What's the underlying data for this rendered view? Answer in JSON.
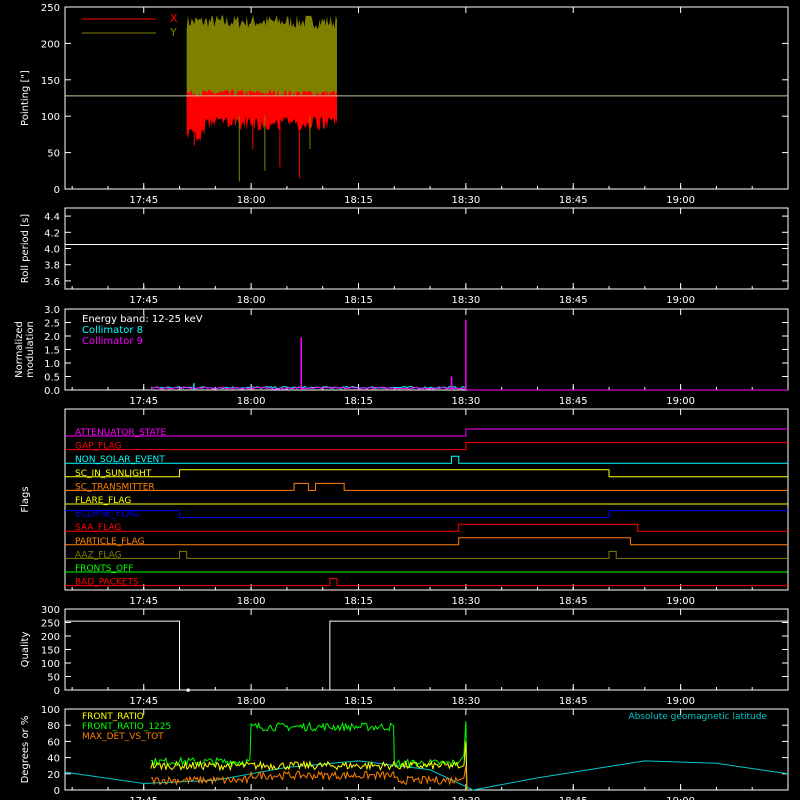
{
  "time_ticks": [
    "17:45",
    "18:00",
    "18:15",
    "18:30",
    "18:45",
    "19:00"
  ],
  "colors": {
    "background": "#000000",
    "axes": "#ffffff",
    "x_series": "#ff0000",
    "y_series": "#808000",
    "collimator_8": "#00ffff",
    "collimator_9": "#ff00ff",
    "front_ratio": "#ffff00",
    "front_ratio_1225": "#00ff00",
    "max_det_vs_tot": "#ff8000",
    "geomag": "#00c8c8"
  },
  "chart_data": [
    {
      "type": "area",
      "ylabel": "Pointing [\"]",
      "ylim": [
        0,
        250
      ],
      "yticks": [
        0,
        50,
        100,
        150,
        200,
        250
      ],
      "xlim": [
        "17:34",
        "19:15"
      ],
      "series": [
        {
          "name": "X",
          "color": "#ff0000",
          "x_range": [
            "17:51",
            "18:12"
          ],
          "band": [
            90,
            135
          ]
        },
        {
          "name": "Y",
          "color": "#808000",
          "x_range": [
            "17:51",
            "18:12"
          ],
          "band": [
            115,
            230
          ]
        }
      ],
      "reference_line": 128
    },
    {
      "type": "line",
      "ylabel": "Roll period [s]",
      "ylim": [
        3.5,
        4.5
      ],
      "yticks": [
        "3.6",
        "3.8",
        "4.0",
        "4.2",
        "4.4"
      ],
      "xlim": [
        "17:34",
        "19:15"
      ],
      "series": [
        {
          "name": "",
          "color": "#ffffff",
          "x": [
            "17:34",
            "19:15"
          ],
          "y": [
            4.05,
            4.05
          ]
        }
      ]
    },
    {
      "type": "line",
      "ylabel": "Normalized modulation",
      "ylim": [
        0,
        3
      ],
      "yticks": [
        "0.0",
        "0.5",
        "1.0",
        "1.5",
        "2.0",
        "2.5",
        "3.0"
      ],
      "xlim": [
        "17:34",
        "19:15"
      ],
      "legend": [
        "Energy band: 12-25 keV",
        "Collimator 8",
        "Collimator 9"
      ],
      "series": [
        {
          "name": "Collimator 8",
          "color": "#00ffff",
          "x_range": [
            "17:46",
            "18:30"
          ],
          "baseline": 0.05,
          "spikes": [
            [
              "17:52",
              0.25
            ],
            [
              "18:28",
              0.2
            ]
          ]
        },
        {
          "name": "Collimator 9",
          "color": "#ff00ff",
          "x_range": [
            "17:46",
            "18:30"
          ],
          "baseline": 0.03,
          "spikes": [
            [
              "18:07",
              1.95
            ],
            [
              "18:30",
              2.6
            ],
            [
              "18:28",
              0.5
            ]
          ]
        }
      ]
    },
    {
      "type": "line",
      "ylabel": "Flags",
      "xlim": [
        "17:34",
        "19:15"
      ],
      "flags": [
        {
          "name": "ATTENUATOR_STATE",
          "color": "#ff00ff",
          "steps": [
            [
              "17:34",
              0
            ],
            [
              "18:30",
              1
            ]
          ]
        },
        {
          "name": "GAP_FLAG",
          "color": "#ff0000",
          "steps": [
            [
              "17:34",
              0
            ],
            [
              "18:30",
              1
            ]
          ]
        },
        {
          "name": "NON_SOLAR_EVENT",
          "color": "#00ffff",
          "steps": [
            [
              "17:34",
              0
            ],
            [
              "18:28",
              1
            ],
            [
              "18:29",
              0
            ]
          ]
        },
        {
          "name": "SC_IN_SUNLIGHT",
          "color": "#ffff00",
          "steps": [
            [
              "17:34",
              0
            ],
            [
              "17:50",
              1
            ],
            [
              "18:50",
              0
            ]
          ]
        },
        {
          "name": "SC_TRANSMITTER",
          "color": "#ff8000",
          "steps": [
            [
              "17:34",
              0
            ],
            [
              "18:06",
              1
            ],
            [
              "18:08",
              0
            ],
            [
              "18:09",
              1
            ],
            [
              "18:13",
              0
            ]
          ]
        },
        {
          "name": "FLARE_FLAG",
          "color": "#ffff00",
          "steps": [
            [
              "17:34",
              0
            ]
          ]
        },
        {
          "name": "ECLIPSE_FLAG",
          "color": "#0000ff",
          "steps": [
            [
              "17:34",
              1
            ],
            [
              "17:50",
              0
            ],
            [
              "18:50",
              1
            ]
          ]
        },
        {
          "name": "SAA_FLAG",
          "color": "#ff0000",
          "steps": [
            [
              "17:34",
              0
            ],
            [
              "18:29",
              1
            ],
            [
              "18:54",
              0
            ]
          ]
        },
        {
          "name": "PARTICLE_FLAG",
          "color": "#ff8000",
          "steps": [
            [
              "17:34",
              0
            ],
            [
              "18:29",
              1
            ],
            [
              "18:53",
              0
            ]
          ]
        },
        {
          "name": "AAZ_FLAG",
          "color": "#808000",
          "steps": [
            [
              "17:34",
              0
            ],
            [
              "17:50",
              1
            ],
            [
              "17:51",
              0
            ],
            [
              "18:50",
              1
            ],
            [
              "18:51",
              0
            ]
          ]
        },
        {
          "name": "FRONTS_OFF",
          "color": "#00ff00",
          "steps": [
            [
              "17:34",
              0
            ]
          ]
        },
        {
          "name": "BAD_PACKETS",
          "color": "#ff0000",
          "steps": [
            [
              "17:34",
              0
            ],
            [
              "18:11",
              1
            ],
            [
              "18:12",
              0
            ]
          ]
        }
      ]
    },
    {
      "type": "line",
      "ylabel": "Quality",
      "ylim": [
        0,
        300
      ],
      "yticks": [
        0,
        50,
        100,
        150,
        200,
        250,
        300
      ],
      "xlim": [
        "17:34",
        "19:15"
      ],
      "series": [
        {
          "name": "",
          "color": "#ffffff",
          "x": [
            "17:34",
            "17:50",
            "17:50",
            "18:11",
            "18:11",
            "19:15"
          ],
          "y": [
            255,
            255,
            0,
            0,
            255,
            255
          ]
        }
      ]
    },
    {
      "type": "line",
      "ylabel": "Degrees or %",
      "ylim": [
        0,
        100
      ],
      "yticks": [
        0,
        20,
        40,
        60,
        80,
        100
      ],
      "xlim": [
        "17:34",
        "19:15"
      ],
      "legend": [
        "FRONT_RATIO",
        "FRONT_RATIO_1225",
        "MAX_DET_VS_TOT",
        "Absolute geomagnetic latitude"
      ],
      "series": [
        {
          "name": "Absolute geomagnetic latitude",
          "color": "#00c8c8",
          "x": [
            "17:34",
            "17:45",
            "17:55",
            "18:05",
            "18:15",
            "18:25",
            "18:31",
            "18:40",
            "18:55",
            "19:05",
            "19:15"
          ],
          "y": [
            22,
            8,
            12,
            28,
            36,
            25,
            0,
            15,
            36,
            33,
            20
          ]
        },
        {
          "name": "FRONT_RATIO_1225",
          "color": "#00ff00",
          "segments": [
            [
              "17:46",
              "18:00",
              35
            ],
            [
              "18:00",
              "18:20",
              78
            ],
            [
              "18:20",
              "18:29",
              33
            ]
          ],
          "spike": [
            "18:30",
            85
          ]
        },
        {
          "name": "FRONT_RATIO",
          "color": "#ffff00",
          "segments": [
            [
              "17:46",
              "18:29",
              30
            ]
          ],
          "spike": [
            "18:30",
            60
          ]
        },
        {
          "name": "MAX_DET_VS_TOT",
          "color": "#ff8000",
          "segments": [
            [
              "17:46",
              "18:00",
              12
            ],
            [
              "18:00",
              "18:20",
              18
            ],
            [
              "18:20",
              "18:29",
              12
            ]
          ],
          "spike": [
            "18:30",
            30
          ]
        }
      ]
    }
  ]
}
